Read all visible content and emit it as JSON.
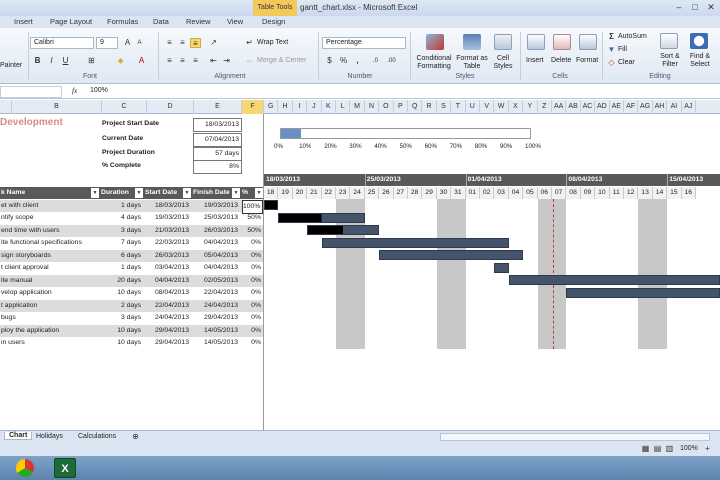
{
  "window": {
    "title": "gantt_chart.xlsx - Microsoft Excel",
    "table_tools": "Table Tools"
  },
  "tabs": [
    "Insert",
    "Page Layout",
    "Formulas",
    "Data",
    "Review",
    "View",
    "Design"
  ],
  "ribbon": {
    "painter": "Painter",
    "font_name": "Calibri",
    "font_size": "9",
    "wrap_text": "Wrap Text",
    "merge_center": "Merge & Center",
    "number_format": "Percentage",
    "conditional_formatting": "Conditional Formatting",
    "format_as_table": "Format as Table",
    "cell_styles": "Cell Styles",
    "insert": "Insert",
    "delete": "Delete",
    "format": "Format",
    "autosum": "AutoSum",
    "fill": "Fill",
    "clear": "Clear",
    "sort_filter": "Sort & Filter",
    "find_select": "Find & Select",
    "groups": {
      "font": "Font",
      "alignment": "Alignment",
      "number": "Number",
      "styles": "Styles",
      "cells": "Cells",
      "editing": "Editing"
    }
  },
  "formula_bar": {
    "fx": "fx",
    "value": "100%"
  },
  "columns": [
    "B",
    "C",
    "D",
    "E",
    "F",
    "G",
    "H",
    "I",
    "J",
    "K",
    "L",
    "M",
    "N",
    "O",
    "P",
    "Q",
    "R",
    "S",
    "T",
    "U",
    "V",
    "W",
    "X",
    "Y",
    "Z",
    "AA",
    "AB",
    "AC",
    "AD",
    "AE",
    "AF",
    "AG",
    "AH",
    "AI",
    "AJ"
  ],
  "project": {
    "title": "Development",
    "start_label": "Project Start Date",
    "start_value": "18/03/2013",
    "current_label": "Current Date",
    "current_value": "07/04/2013",
    "duration_label": "Project Duration",
    "duration_value": "57 days",
    "complete_label": "% Complete",
    "complete_value": "8%"
  },
  "progress_scale": [
    "0%",
    "10%",
    "20%",
    "30%",
    "40%",
    "50%",
    "60%",
    "70%",
    "80%",
    "90%",
    "100%"
  ],
  "progress_fraction": 0.08,
  "weeks": [
    "18/03/2013",
    "25/03/2013",
    "01/04/2013",
    "08/04/2013",
    "15/04/2013"
  ],
  "days": [
    "18",
    "19",
    "20",
    "21",
    "22",
    "23",
    "24",
    "25",
    "26",
    "27",
    "28",
    "29",
    "30",
    "31",
    "01",
    "02",
    "03",
    "04",
    "05",
    "06",
    "07",
    "08",
    "09",
    "10",
    "11",
    "12",
    "13",
    "14",
    "15",
    "16"
  ],
  "table": {
    "headers": [
      "k Name",
      "Duration",
      "Start Date",
      "Finish Date",
      "%"
    ],
    "rows": [
      [
        "et with client",
        "1 days",
        "18/03/2013",
        "19/03/2013",
        "100%"
      ],
      [
        "ntify scope",
        "4 days",
        "19/03/2013",
        "25/03/2013",
        "50%"
      ],
      [
        "end time with users",
        "3 days",
        "21/03/2013",
        "26/03/2013",
        "50%"
      ],
      [
        "ite functional specifications",
        "7 days",
        "22/03/2013",
        "04/04/2013",
        "0%"
      ],
      [
        "sign storyboards",
        "6 days",
        "26/03/2013",
        "05/04/2013",
        "0%"
      ],
      [
        "t client approval",
        "1 days",
        "03/04/2013",
        "04/04/2013",
        "0%"
      ],
      [
        "ite manual",
        "20 days",
        "04/04/2013",
        "02/05/2013",
        "0%"
      ],
      [
        "velop application",
        "10 days",
        "08/04/2013",
        "22/04/2013",
        "0%"
      ],
      [
        "t application",
        "2 days",
        "22/04/2013",
        "24/04/2013",
        "0%"
      ],
      [
        "bugs",
        "3 days",
        "24/04/2013",
        "29/04/2013",
        "0%"
      ],
      [
        "ploy the application",
        "10 days",
        "29/04/2013",
        "14/05/2013",
        "0%"
      ],
      [
        "in users",
        "10 days",
        "29/04/2013",
        "14/05/2013",
        "0%"
      ]
    ]
  },
  "sheet_tabs": [
    "Chart",
    "Holidays",
    "Calculations"
  ],
  "status": {
    "zoom": "100%"
  }
}
